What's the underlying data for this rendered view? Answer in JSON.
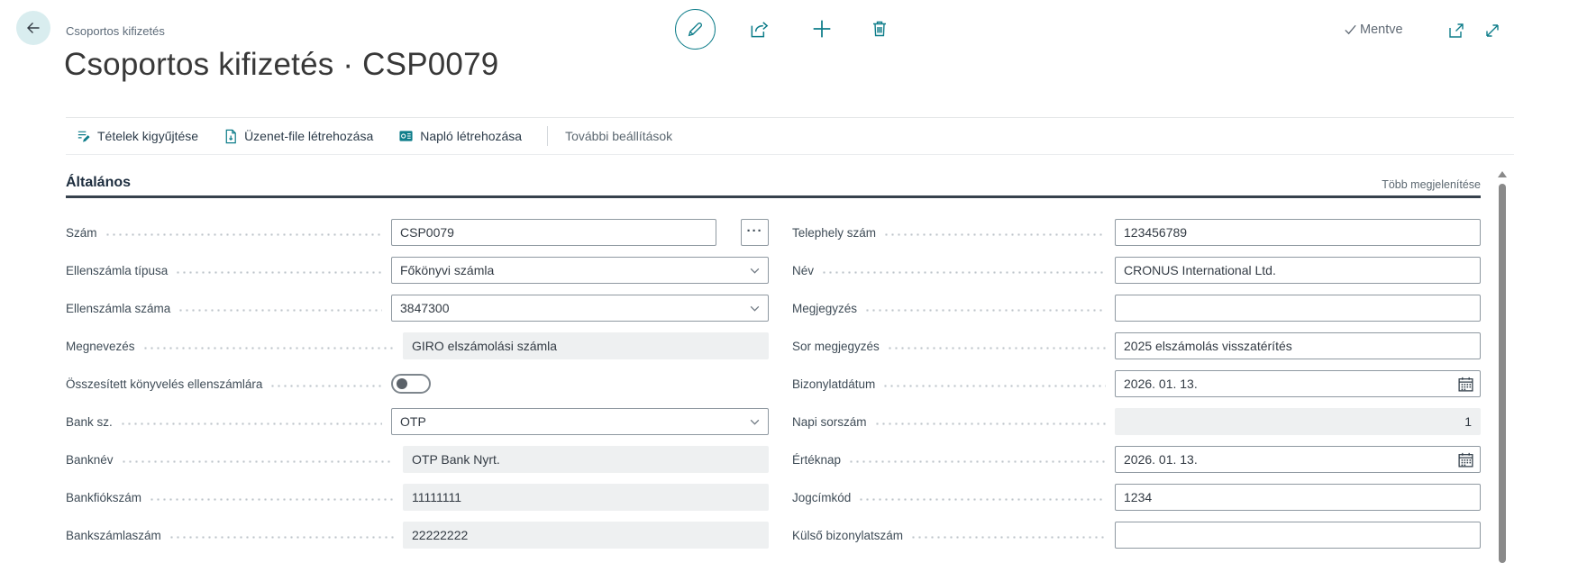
{
  "header": {
    "breadcrumb": "Csoportos kifizetés",
    "title": "Csoportos kifizetés · CSP0079",
    "save_status": "Mentve"
  },
  "action_bar": {
    "items": [
      {
        "label": "Tételek kigyűjtése"
      },
      {
        "label": "Üzenet-file létrehozása"
      },
      {
        "label": "Napló létrehozása"
      }
    ],
    "more_label": "További beállítások"
  },
  "section": {
    "title": "Általános",
    "show_more_label": "Több megjelenítése"
  },
  "icons": {
    "assist_edit": "···"
  },
  "form": {
    "left": [
      {
        "label": "Szám",
        "value": "CSP0079",
        "type": "assist"
      },
      {
        "label": "Ellenszámla típusa",
        "value": "Főkönyvi számla",
        "type": "dropdown"
      },
      {
        "label": "Ellenszámla száma",
        "value": "3847300",
        "type": "dropdown"
      },
      {
        "label": "Megnevezés",
        "value": "GIRO elszámolási számla",
        "type": "readonly"
      },
      {
        "label": "Összesített könyvelés ellenszámlára",
        "value": "off",
        "type": "toggle"
      },
      {
        "label": "Bank sz.",
        "value": "OTP",
        "type": "dropdown"
      },
      {
        "label": "Banknév",
        "value": "OTP Bank Nyrt.",
        "type": "readonly"
      },
      {
        "label": "Bankfiókszám",
        "value": "11111111",
        "type": "readonly"
      },
      {
        "label": "Bankszámlaszám",
        "value": "22222222",
        "type": "readonly"
      }
    ],
    "right": [
      {
        "label": "Telephely szám",
        "value": "123456789",
        "type": "text"
      },
      {
        "label": "Név",
        "value": "CRONUS International Ltd.",
        "type": "text"
      },
      {
        "label": "Megjegyzés",
        "value": "",
        "type": "text"
      },
      {
        "label": "Sor megjegyzés",
        "value": "2025 elszámolás visszatérítés",
        "type": "text"
      },
      {
        "label": "Bizonylatdátum",
        "value": "2026. 01. 13.",
        "type": "date"
      },
      {
        "label": "Napi sorszám",
        "value": "1",
        "type": "readonly"
      },
      {
        "label": "Értéknap",
        "value": "2026. 01. 13.",
        "type": "date"
      },
      {
        "label": "Jogcímkód",
        "value": "1234",
        "type": "text"
      },
      {
        "label": "Külső bizonylatszám",
        "value": "",
        "type": "text"
      }
    ]
  },
  "colors": {
    "accent": "#0e7d8a",
    "back_circle_bg": "#d9edef",
    "section_underline": "#37424d",
    "readonly_bg": "#eef0f1",
    "field_border": "#8f99a1",
    "muted_text": "#5b6770"
  }
}
